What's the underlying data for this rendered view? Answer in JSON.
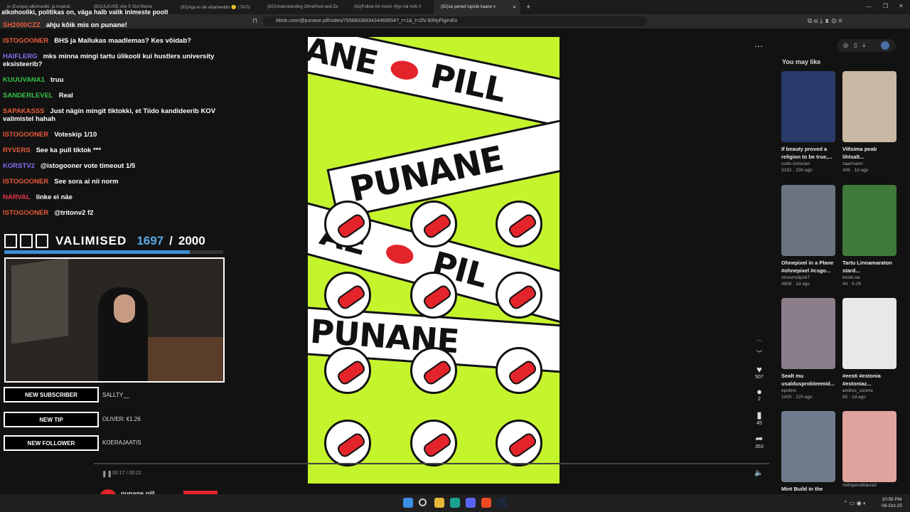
{
  "tabs": [
    {
      "label": "ie (Europe) alkohooliki, ja inspirat"
    },
    {
      "label": "(82)ULKUSE ohe S Stol Mome"
    },
    {
      "label": "(82)Aga ei ole ebameeldiv 🙂 | TikTo"
    },
    {
      "label": "(82)Understanding OhnePixel and Ze"
    },
    {
      "label": "(82)Follow for more! #fyp #ai #ufc #"
    },
    {
      "label": "(82)sa paned topsile kaane v"
    }
  ],
  "address": {
    "url": "tiktok.com/@punane.pill/video/7558803893434469654?_r=1&_t=ZN-90NyFlgimEo"
  },
  "chat": {
    "overlay_top": "alkohooliki, politikas on, väga halb valik inimeste poolt",
    "messages": [
      {
        "user": "SH2000CZZ",
        "text": "ahju kõik mis on punane!",
        "color": "#e85b3a"
      },
      {
        "user": "ISTOGOONER",
        "text": "BHS ja Mallukas maadlemas? Kes võidab?",
        "color": "#e85b3a"
      },
      {
        "user": "HAIFLERG",
        "text": "mks minna mingi tartu ülikooli kui hustlers university eksisteerib?",
        "color": "#8a6cf0"
      },
      {
        "user": "KUUUVANA1",
        "text": "truu",
        "color": "#36c24a"
      },
      {
        "user": "SANDERLEVEL",
        "text": "Real",
        "color": "#36c24a"
      },
      {
        "user": "SAPAKASSS",
        "text": "Just nägin mingit tiktokki, et Tiido kandideerib KOV valimistel hahah",
        "color": "#e85b3a"
      },
      {
        "user": "ISTOGOONER",
        "text": "Voteskip 1/10",
        "color": "#e85b3a"
      },
      {
        "user": "RYVERS",
        "text": "See ka pull tiktok ***",
        "color": "#e85b3a"
      },
      {
        "user": "KORSTV2",
        "text": "@istogooner vote timeout 1/5",
        "color": "#8a6cf0"
      },
      {
        "user": "ISTOGOONER",
        "text": "See sora ai nii norm",
        "color": "#e85b3a"
      },
      {
        "user": "NARVAL",
        "text": "linke ei näe",
        "color": "#e8344a"
      },
      {
        "user": "ISTOGOONER",
        "text": "@tritonv2 f2",
        "color": "#e85b3a"
      }
    ]
  },
  "goal": {
    "title": "VALIMISED",
    "current": "1697",
    "separator": "/",
    "target": "2000",
    "progress": 0.8485
  },
  "alerts": [
    {
      "label": "NEW SUBSCRIBER",
      "value": "SALLTY__"
    },
    {
      "label": "NEW TIP",
      "value": "OLIVER: €1.26"
    },
    {
      "label": "NEW FOLLOWER",
      "value": "KOERAJAATIS"
    }
  ],
  "video": {
    "band1": "ANE",
    "band2": "PILL",
    "band3": "PUNANE",
    "band4": "PIL",
    "band5": "PUNANE",
    "time": "00:17 / 00:21",
    "creator": "punane.pill"
  },
  "actions": {
    "likes": "507",
    "comments": "2",
    "saves": "45",
    "shares": "353"
  },
  "sidebar": {
    "title": "You may like",
    "cards": [
      {
        "title": "If beauty proved a religion to be true,...",
        "author": "code.victorian",
        "views": "3182",
        "age": "23h ago",
        "color": "#2a3a6a"
      },
      {
        "title": "Viltsima peab lihtsalt...",
        "author": "zaarmann",
        "views": "436",
        "age": "1d ago",
        "color": "#c9b8a4"
      },
      {
        "title": "Ohnepixel in a Plane #ohnepixel #csgo...",
        "author": "streamclips67",
        "views": "4806",
        "age": "1d ago",
        "color": "#6b7280"
      },
      {
        "title": "Tartu Linnamaraton stard...",
        "author": "treski.ee",
        "views": "44",
        "age": "9-26",
        "color": "#3f7a3a"
      },
      {
        "title": "Sealt mu usaldusprobleemid...",
        "author": "epuline",
        "views": "1420",
        "age": "22h ago",
        "color": "#8b7d8a"
      },
      {
        "title": "#eesti #estonia #estoniaz...",
        "author": "andrus_soome",
        "views": "85",
        "age": "1d ago",
        "color": "#e8e8e8"
      },
      {
        "title": "Mint Build in the",
        "author": "",
        "views": "",
        "age": "",
        "color": "#6e7b8c"
      },
      {
        "title": "",
        "author": "nettspendilaura0",
        "views": "",
        "age": "",
        "color": "#e0a39e"
      }
    ]
  },
  "clock": {
    "time": "10:58 PM",
    "date": "08-Oct-25"
  }
}
